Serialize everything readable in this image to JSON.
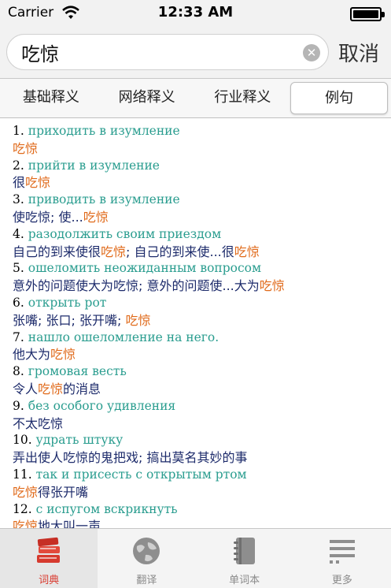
{
  "status_bar": {
    "carrier": "Carrier",
    "time": "12:33 AM"
  },
  "search": {
    "query": "吃惊",
    "cancel_label": "取消"
  },
  "tabs": [
    {
      "label": "基础释义",
      "active": false
    },
    {
      "label": "网络释义",
      "active": false
    },
    {
      "label": "行业释义",
      "active": false
    },
    {
      "label": "例句",
      "active": true
    }
  ],
  "examples": [
    {
      "num": "1.",
      "ru": "приходить в изумление",
      "zh": [
        {
          "t": "吃惊",
          "h": true
        }
      ]
    },
    {
      "num": "2.",
      "ru": "прийти в изумление",
      "zh": [
        {
          "t": "很",
          "h": false
        },
        {
          "t": "吃惊",
          "h": true
        }
      ]
    },
    {
      "num": "3.",
      "ru": "приводить в изумление",
      "zh": [
        {
          "t": "使吃惊; 使...",
          "h": false
        },
        {
          "t": "吃惊",
          "h": true
        }
      ]
    },
    {
      "num": "4.",
      "ru": "разодолжить своим приездом",
      "zh": [
        {
          "t": "自己的到来使很",
          "h": false
        },
        {
          "t": "吃惊",
          "h": true
        },
        {
          "t": "; 自己的到来使...很",
          "h": false
        },
        {
          "t": "吃惊",
          "h": true
        }
      ]
    },
    {
      "num": "5.",
      "ru": "ошеломить неожиданным вопросом",
      "zh": [
        {
          "t": "意外的问题使大为吃惊; 意外的问题使...大为",
          "h": false
        },
        {
          "t": "吃惊",
          "h": true
        }
      ]
    },
    {
      "num": "6.",
      "ru": "открыть рот",
      "zh": [
        {
          "t": "张嘴; 张口; 张开嘴; ",
          "h": false
        },
        {
          "t": "吃惊",
          "h": true
        }
      ]
    },
    {
      "num": "7.",
      "ru": "нашло ошеломление на него.",
      "zh": [
        {
          "t": "他大为",
          "h": false
        },
        {
          "t": "吃惊",
          "h": true
        }
      ]
    },
    {
      "num": "8.",
      "ru": "громовая весть",
      "zh": [
        {
          "t": "令人",
          "h": false
        },
        {
          "t": "吃惊",
          "h": true
        },
        {
          "t": "的消息",
          "h": false
        }
      ]
    },
    {
      "num": "9.",
      "ru": "без особого удивления",
      "zh": [
        {
          "t": "不太吃惊",
          "h": false
        }
      ]
    },
    {
      "num": "10.",
      "ru": "удрать штуку",
      "zh": [
        {
          "t": "弄出使人吃惊的鬼把戏; 搞出莫名其妙的事",
          "h": false
        }
      ]
    },
    {
      "num": "11.",
      "ru": "так и присесть с открытым ртом",
      "zh": [
        {
          "t": "吃惊",
          "h": true
        },
        {
          "t": "得张开嘴",
          "h": false
        }
      ]
    },
    {
      "num": "12.",
      "ru": "с испугом вскрикнуть",
      "zh": [
        {
          "t": "吃惊",
          "h": true
        },
        {
          "t": "地大叫一声",
          "h": false
        }
      ]
    }
  ],
  "tabbar": [
    {
      "label": "词典",
      "icon": "dictionary-book-icon",
      "active": true
    },
    {
      "label": "翻译",
      "icon": "globe-icon",
      "active": false
    },
    {
      "label": "单词本",
      "icon": "notebook-icon",
      "active": false
    },
    {
      "label": "更多",
      "icon": "menu-lines-icon",
      "active": false
    }
  ],
  "colors": {
    "russian_text": "#2a9d8f",
    "chinese_text": "#1d2b6b",
    "highlight": "#e06a1a",
    "active_tab": "#d93a2f"
  }
}
